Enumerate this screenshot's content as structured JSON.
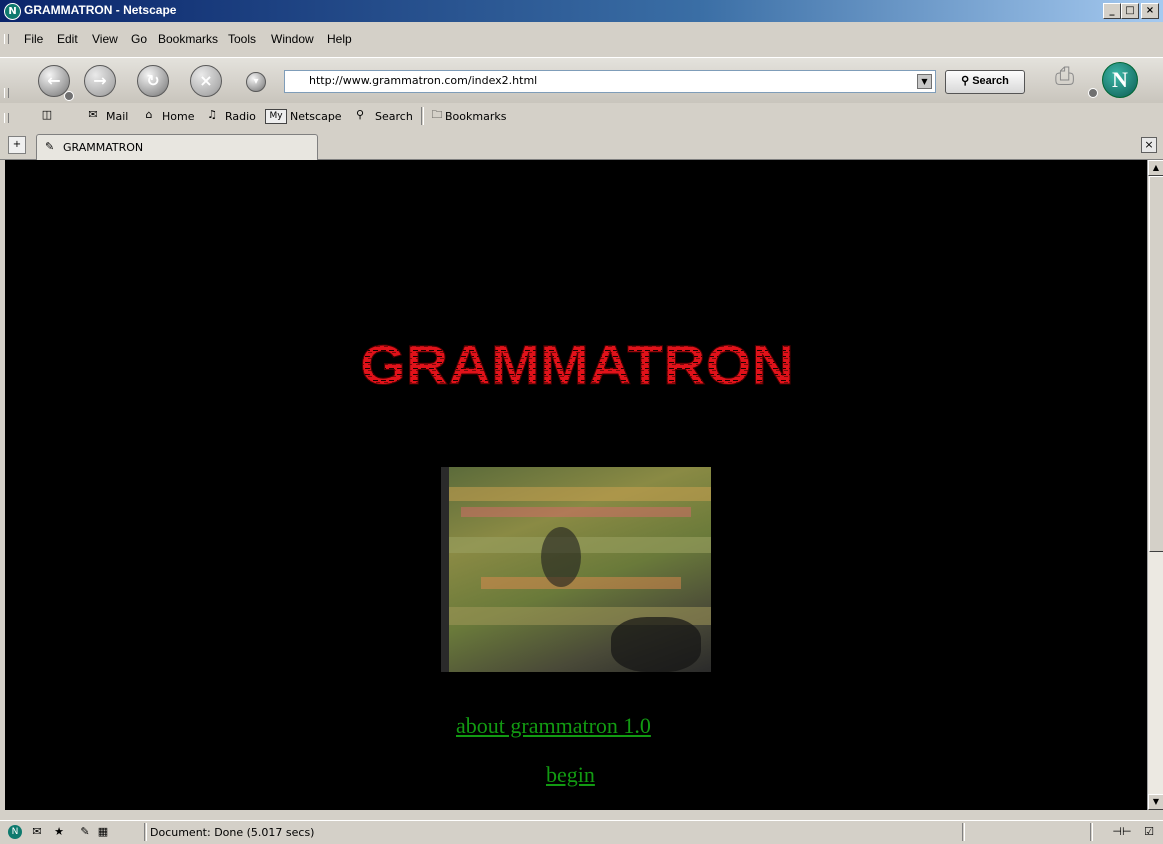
{
  "window": {
    "title": "GRAMMATRON - Netscape",
    "min": "_",
    "max": "□",
    "close": "×"
  },
  "menu": [
    "File",
    "Edit",
    "View",
    "Go",
    "Bookmarks",
    "Tools",
    "Window",
    "Help"
  ],
  "nav": {
    "url": "http://www.grammatron.com/index2.html",
    "search_label": "Search"
  },
  "personal_toolbar": {
    "mail": "Mail",
    "home": "Home",
    "radio": "Radio",
    "my_badge": "My",
    "netscape": "Netscape",
    "search": "Search",
    "bookmarks": "Bookmarks"
  },
  "tab": {
    "label": "GRAMMATRON"
  },
  "page": {
    "logo_text": "GRAMMATRON",
    "links": [
      {
        "label": "about grammatron 1.0"
      },
      {
        "label": "begin"
      },
      {
        "label": "… (“… … …”)"
      }
    ]
  },
  "status": {
    "text": "Document: Done (5.017 secs)"
  },
  "colors": {
    "link": "#129a12",
    "logo": "#e0121a",
    "background": "#000000"
  }
}
